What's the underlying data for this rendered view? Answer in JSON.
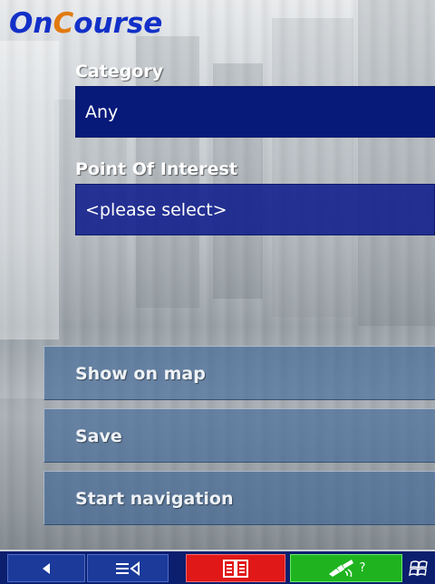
{
  "app": {
    "logo_on": "On",
    "logo_c": "C",
    "logo_ourse": "ourse",
    "brand_color": "#1230c8",
    "accent_color": "#e07a10"
  },
  "form": {
    "category": {
      "label": "Category",
      "value": "Any"
    },
    "poi": {
      "label": "Point Of Interest",
      "value": "<please select>"
    }
  },
  "actions": [
    {
      "label": "Show on map"
    },
    {
      "label": "Save"
    },
    {
      "label": "Start navigation"
    }
  ],
  "taskbar": {
    "back_icon": "back-arrow-icon",
    "menu_icon": "menu-lines-icon",
    "book_icon": "book-icon",
    "gps_icon": "satellite-icon",
    "gps_status": "?",
    "windows_icon": "windows-flag-icon",
    "colors": {
      "book": "#e01818",
      "gps": "#1fb41f",
      "bar": "#0b1f6e"
    }
  }
}
